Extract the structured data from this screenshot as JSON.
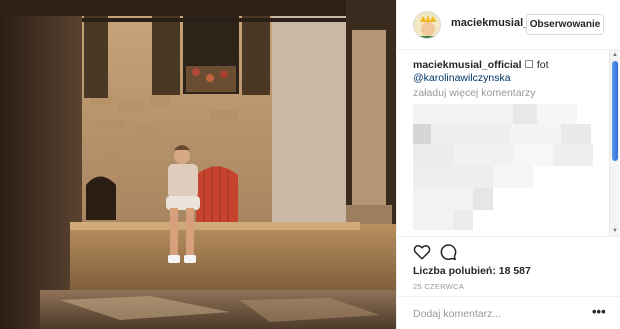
{
  "post": {
    "photo_alt": "photo",
    "author": {
      "username": "maciekmusial_",
      "follow_label": "Obserwowanie"
    },
    "caption": {
      "username": "maciekmusial_official",
      "text": "☐ fot",
      "mention": "@karolinawilczynska"
    },
    "load_more_label": "załaduj więcej komentarzy",
    "likes_text": "Liczba polubień: 18 587",
    "date_text": "25 CZERWCA",
    "comment_placeholder": "Dodaj komentarz...",
    "more_options_label": "•••"
  },
  "icons": {
    "like": "heart-icon",
    "comment": "comment-bubble-icon"
  },
  "colors": {
    "mention": "#003569",
    "muted_text": "#999999",
    "scrollbar_thumb": "#2f6fd6"
  }
}
